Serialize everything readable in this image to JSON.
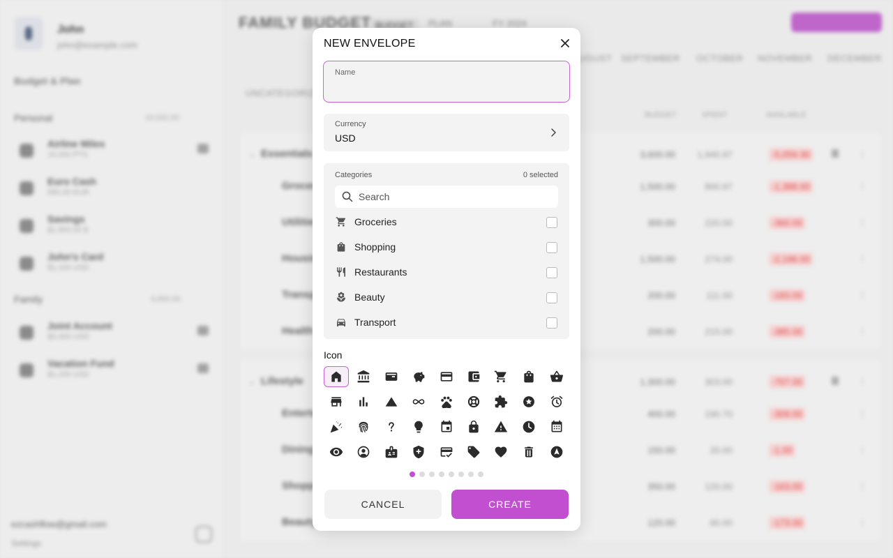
{
  "sidebar": {
    "user": {
      "name": "John",
      "email": "john@example.com"
    },
    "budget_title": "Budget & Plan",
    "groups": [
      {
        "name": "Personal",
        "total": "10,532.00",
        "accounts": [
          {
            "name": "Airline Miles",
            "sub": "15,000 PTS",
            "icon": "plane-icon"
          },
          {
            "name": "Euro Cash",
            "sub": "€80.00 EUR",
            "icon": "euro-icon"
          },
          {
            "name": "Savings",
            "sub": "$1,900.00 $",
            "icon": "bank-icon"
          },
          {
            "name": "John's Card",
            "sub": "$1,100 USD",
            "icon": "card-icon"
          }
        ]
      },
      {
        "name": "Family",
        "total": "4,600.00",
        "accounts": [
          {
            "name": "Joint Account",
            "sub": "$3,400 USD",
            "icon": "bank-icon"
          },
          {
            "name": "Vacation Fund",
            "sub": "$1,200 USD",
            "icon": "plane-icon"
          }
        ]
      }
    ],
    "footer_user": "ezcashflow@gmail.com",
    "footer_settings": "Settings"
  },
  "main": {
    "title": "FAMILY BUDGET",
    "tabs": [
      "BUDGET",
      "PLAN"
    ],
    "year": "FY 2024",
    "months": [
      "AUGUST",
      "SEPTEMBER",
      "OCTOBER",
      "NOVEMBER",
      "DECEMBER"
    ],
    "columns": [
      "BUDGET",
      "SPENT",
      "AVAILABLE"
    ],
    "uncategorized": "UNCATEGORIZED",
    "rows": [
      {
        "name": "Essentials",
        "budget": "3,600.00",
        "spent": "1,940.97",
        "avail": "-5,059.30",
        "group": true
      },
      {
        "name": "Groceries",
        "budget": "1,500.00",
        "spent": "800.97",
        "avail": "-1,388.00"
      },
      {
        "name": "Utilities",
        "budget": "300.00",
        "spent": "220.00",
        "avail": "-360.00"
      },
      {
        "name": "Housing",
        "budget": "1,500.00",
        "spent": "274.00",
        "avail": "-2,196.00"
      },
      {
        "name": "Transport",
        "budget": "200.00",
        "spent": "111.00",
        "avail": "-183.00"
      },
      {
        "name": "Health",
        "budget": "200.00",
        "spent": "215.00",
        "avail": "-385.00"
      },
      {
        "name": "Lifestyle",
        "budget": "1,300.00",
        "spent": "303.00",
        "avail": "-707.00",
        "group": true
      },
      {
        "name": "Entertainment",
        "budget": "400.00",
        "spent": "190.70",
        "avail": "-309.00"
      },
      {
        "name": "Dining",
        "budget": "150.00",
        "spent": "20.00",
        "avail": "-1.00"
      },
      {
        "name": "Shopping",
        "budget": "350.00",
        "spent": "120.00",
        "avail": "-163.00"
      },
      {
        "name": "Beauty",
        "budget": "120.00",
        "spent": "60.00",
        "avail": "-173.00"
      }
    ]
  },
  "modal": {
    "title": "NEW ENVELOPE",
    "name_label": "Name",
    "name_value": "",
    "currency_label": "Currency",
    "currency_value": "USD",
    "categories_label": "Categories",
    "selected_count": "0 selected",
    "search_placeholder": "Search",
    "categories": [
      {
        "name": "Groceries",
        "icon": "cart-icon",
        "checked": false
      },
      {
        "name": "Shopping",
        "icon": "bag-icon",
        "checked": false
      },
      {
        "name": "Restaurants",
        "icon": "fork-knife-icon",
        "checked": false
      },
      {
        "name": "Beauty",
        "icon": "spa-icon",
        "checked": false
      },
      {
        "name": "Transport",
        "icon": "car-icon",
        "checked": false
      }
    ],
    "icon_section_label": "Icon",
    "icon_grid": [
      [
        "home",
        "bank",
        "wallet-card",
        "piggy",
        "card",
        "wallet",
        "cart",
        "bag",
        "basket"
      ],
      [
        "store",
        "chart",
        "triangle",
        "infinity",
        "paw",
        "lifebuoy",
        "puzzle",
        "star-badge",
        "alarm"
      ],
      [
        "party",
        "fingerprint",
        "question",
        "bulb",
        "calendar",
        "lock",
        "warning",
        "clock",
        "calendar-grid"
      ],
      [
        "eye",
        "user-circle",
        "badge",
        "shield-plus",
        "card-check",
        "tag",
        "heart",
        "trash",
        "navigation"
      ]
    ],
    "selected_icon": "home",
    "page_count": 8,
    "current_page": 0,
    "cancel_label": "CANCEL",
    "create_label": "CREATE",
    "accent_color": "#c24fd0"
  }
}
